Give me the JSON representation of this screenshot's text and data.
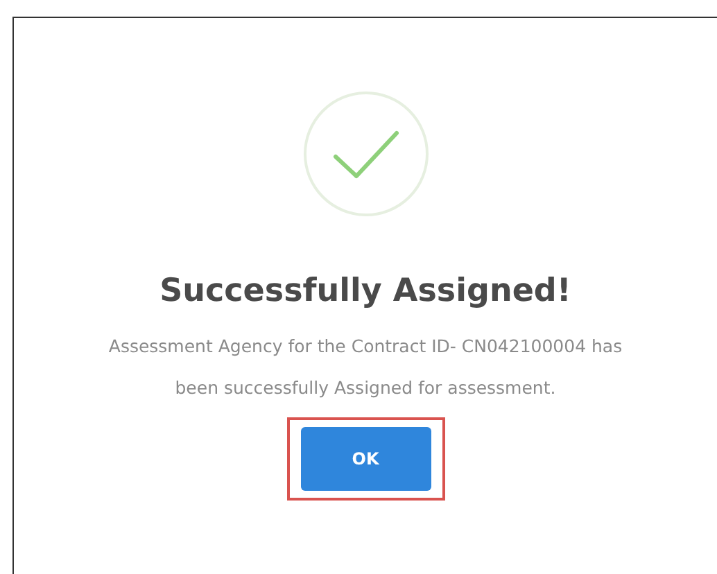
{
  "dialog": {
    "title": "Successfully Assigned!",
    "message": "Assessment Agency for the Contract ID- CN042100004 has been successfully Assigned for assessment.",
    "button": {
      "label": "OK",
      "highlighted": true
    }
  }
}
